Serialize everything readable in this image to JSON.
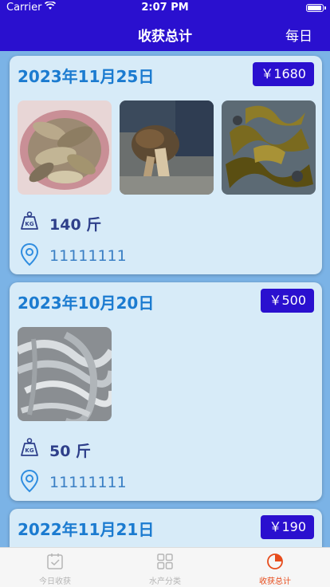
{
  "status_bar": {
    "carrier": "Carrier",
    "time": "2:07 PM"
  },
  "nav": {
    "title": "收获总计",
    "right": "每日"
  },
  "records": [
    {
      "date": "2023年11月25日",
      "price": "￥1680",
      "weight": "140 斤",
      "location": "11111111",
      "photos": [
        "fish-basket-photo",
        "crayfish-photo",
        "kelp-photo"
      ]
    },
    {
      "date": "2023年10月20日",
      "price": "￥500",
      "weight": "50 斤",
      "location": "11111111",
      "photos": [
        "hairtail-photo"
      ]
    },
    {
      "date": "2022年11月21日",
      "price": "￥190"
    }
  ],
  "tabs": [
    {
      "label": "今日收获",
      "icon": "checklist-icon",
      "active": false
    },
    {
      "label": "水产分类",
      "icon": "grid-icon",
      "active": false
    },
    {
      "label": "收获总计",
      "icon": "pie-chart-icon",
      "active": true
    }
  ],
  "colors": {
    "primary": "#2a10cf",
    "accent_blue": "#1b7bd0",
    "card": "#d7ebf8",
    "background": "#7bb3e6",
    "active_tab": "#e74c1c"
  }
}
